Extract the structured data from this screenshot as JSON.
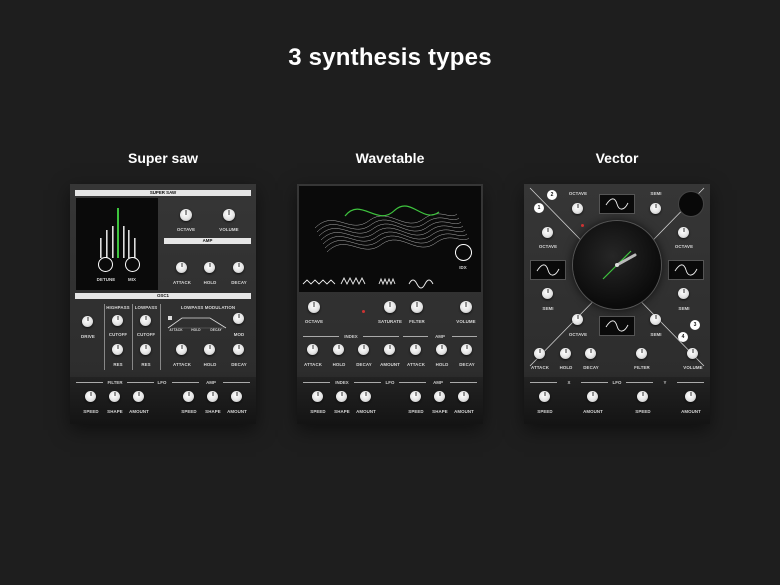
{
  "page": {
    "title": "3 synthesis types"
  },
  "panels": [
    {
      "name": "Super saw"
    },
    {
      "name": "Wavetable"
    },
    {
      "name": "Vector"
    }
  ],
  "supersaw": {
    "header": "SUPER SAW",
    "octave": "OCTAVE",
    "volume": "VOLUME",
    "mix": "MIX",
    "amp": "AMP",
    "attack": "ATTACK",
    "hold": "HOLD",
    "decay": "DECAY",
    "osc1": "OSC1",
    "drive": "DRIVE",
    "highpass": "HIGHPASS",
    "lowpass": "LOWPASS",
    "cutoff": "CUTOFF",
    "res": "RES",
    "lowpass_mod": "LOWPASS MODULATION",
    "mod": "MOD",
    "env_attack": "ATTACK",
    "env_hold": "HOLD",
    "env_decay": "DECAY",
    "filter": "FILTER",
    "lfo": "LFO",
    "speed": "SPEED",
    "shape": "SHAPE",
    "amount": "AMOUNT",
    "accent": "#3ec43e"
  },
  "wavetable": {
    "idx": "IDX",
    "octave": "OCTAVE",
    "saturate": "SATURATE",
    "filter": "FILTER",
    "volume": "VOLUME",
    "index": "INDEX",
    "amp": "AMP",
    "attack": "ATTACK",
    "hold": "HOLD",
    "decay": "DECAY",
    "amount": "AMOUNT",
    "lfo": "LFO",
    "speed": "SPEED",
    "shape": "SHAPE",
    "accent": "#3ec43e"
  },
  "vector": {
    "octave": "OCTAVE",
    "semi": "SEMI",
    "n1": "1",
    "n2": "2",
    "n3": "3",
    "n4": "4",
    "attack": "ATTACK",
    "hold": "HOLD",
    "decay": "DECAY",
    "filter": "FILTER",
    "volume": "VOLUME",
    "x": "X",
    "y": "Y",
    "lfo": "LFO",
    "speed": "SPEED",
    "amount": "AMOUNT",
    "accent": "#3ec43e"
  }
}
